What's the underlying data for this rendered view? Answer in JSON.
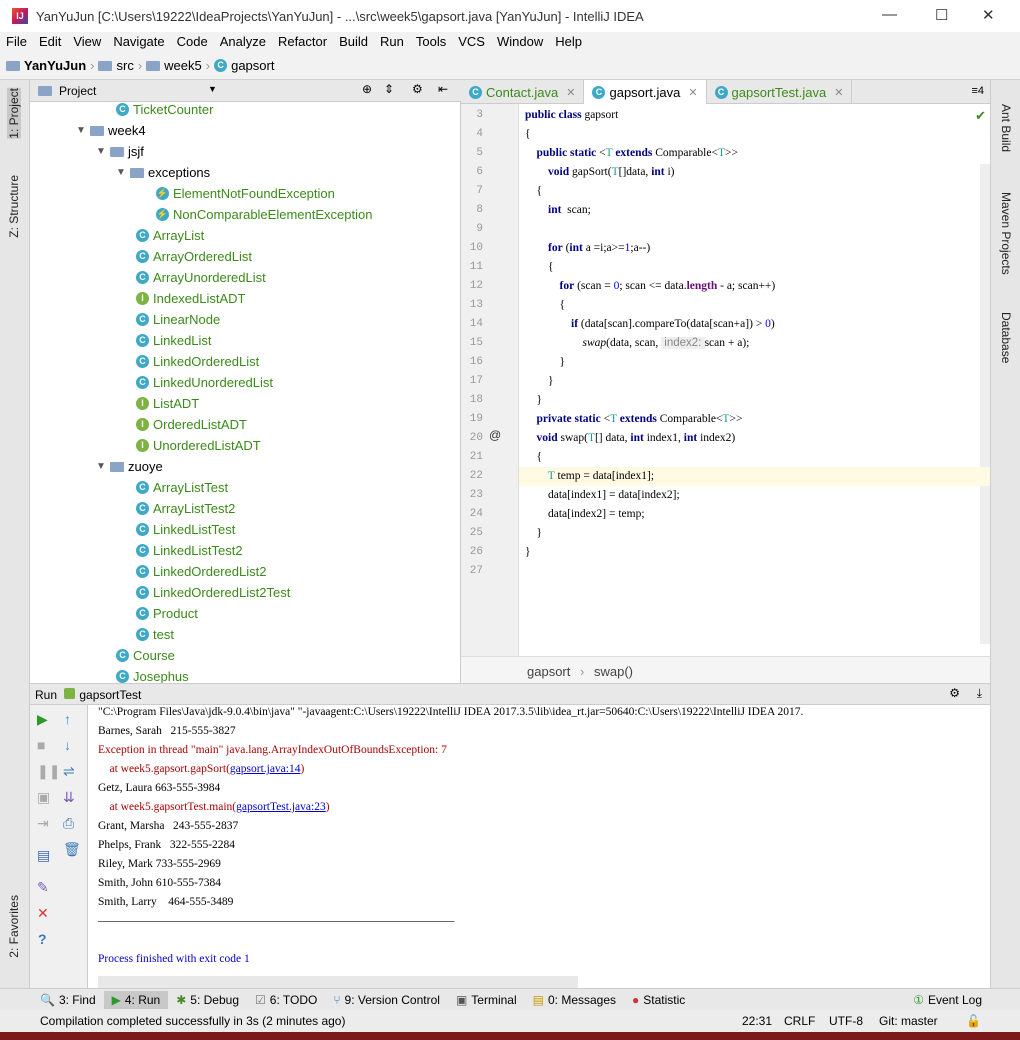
{
  "window": {
    "title": "YanYuJun [C:\\Users\\19222\\IdeaProjects\\YanYuJun] - ...\\src\\week5\\gapsort.java [YanYuJun] - IntelliJ IDEA",
    "minimize": "—",
    "maximize": "☐",
    "close": "✕"
  },
  "menu": [
    "File",
    "Edit",
    "View",
    "Navigate",
    "Code",
    "Analyze",
    "Refactor",
    "Build",
    "Run",
    "Tools",
    "VCS",
    "Window",
    "Help"
  ],
  "breadcrumb": [
    "YanYuJun",
    "src",
    "week5",
    "gapsort"
  ],
  "run_config": "gapsortTest",
  "left_tabs": [
    "1: Project",
    "Z: Structure",
    "2: Favorites"
  ],
  "right_tabs": [
    "Ant Build",
    "Maven Projects",
    "Database"
  ],
  "project_panel": {
    "title": "Project"
  },
  "tree": [
    {
      "label": "TicketCounter",
      "level": 1,
      "icon": "class",
      "kind": "file"
    },
    {
      "label": "week4",
      "level": 0,
      "icon": "folder",
      "kind": "dir"
    },
    {
      "label": "jsjf",
      "level": 1,
      "icon": "folder",
      "kind": "dir"
    },
    {
      "label": "exceptions",
      "level": 2,
      "icon": "folder",
      "kind": "dir"
    },
    {
      "label": "ElementNotFoundException",
      "level": 3,
      "icon": "exception",
      "kind": "file"
    },
    {
      "label": "NonComparableElementException",
      "level": 3,
      "icon": "exception",
      "kind": "file"
    },
    {
      "label": "ArrayList",
      "level": 2,
      "icon": "class",
      "kind": "file"
    },
    {
      "label": "ArrayOrderedList",
      "level": 2,
      "icon": "class",
      "kind": "file"
    },
    {
      "label": "ArrayUnorderedList",
      "level": 2,
      "icon": "class",
      "kind": "file"
    },
    {
      "label": "IndexedListADT",
      "level": 2,
      "icon": "interface",
      "kind": "file"
    },
    {
      "label": "LinearNode",
      "level": 2,
      "icon": "class",
      "kind": "file"
    },
    {
      "label": "LinkedList",
      "level": 2,
      "icon": "class",
      "kind": "file"
    },
    {
      "label": "LinkedOrderedList",
      "level": 2,
      "icon": "class",
      "kind": "file"
    },
    {
      "label": "LinkedUnorderedList",
      "level": 2,
      "icon": "class",
      "kind": "file"
    },
    {
      "label": "ListADT",
      "level": 2,
      "icon": "interface",
      "kind": "file"
    },
    {
      "label": "OrderedListADT",
      "level": 2,
      "icon": "interface",
      "kind": "file"
    },
    {
      "label": "UnorderedListADT",
      "level": 2,
      "icon": "interface",
      "kind": "file"
    },
    {
      "label": "zuoye",
      "level": 1,
      "icon": "folder",
      "kind": "dir"
    },
    {
      "label": "ArrayListTest",
      "level": 2,
      "icon": "class-main",
      "kind": "file"
    },
    {
      "label": "ArrayListTest2",
      "level": 2,
      "icon": "class-main",
      "kind": "file"
    },
    {
      "label": "LinkedListTest",
      "level": 2,
      "icon": "class-main",
      "kind": "file"
    },
    {
      "label": "LinkedListTest2",
      "level": 2,
      "icon": "class-main",
      "kind": "file"
    },
    {
      "label": "LinkedOrderedList2",
      "level": 2,
      "icon": "class",
      "kind": "file"
    },
    {
      "label": "LinkedOrderedList2Test",
      "level": 2,
      "icon": "class-main",
      "kind": "file"
    },
    {
      "label": "Product",
      "level": 2,
      "icon": "class",
      "kind": "file"
    },
    {
      "label": "test",
      "level": 2,
      "icon": "class-main",
      "kind": "file"
    },
    {
      "label": "Course",
      "level": 1,
      "icon": "class",
      "kind": "file"
    },
    {
      "label": "Josephus",
      "level": 1,
      "icon": "class-main",
      "kind": "file"
    }
  ],
  "editor_tabs": [
    {
      "label": "Contact.java",
      "active": false
    },
    {
      "label": "gapsort.java",
      "active": true
    },
    {
      "label": "gapsortTest.java",
      "active": false
    }
  ],
  "tabs_overflow": "≡4",
  "code_lines": [
    {
      "n": "3",
      "html": "<b style='color:#000080'>public class</b> gapsort"
    },
    {
      "n": "4",
      "html": "{"
    },
    {
      "n": "5",
      "html": "    <b style='color:#000080'>public static</b> &lt;<span style='color:#20999d'>T</span> <b style='color:#000080'>extends</b> Comparable&lt;<span style='color:#20999d'>T</span>&gt;&gt;"
    },
    {
      "n": "6",
      "html": "        <b style='color:#000080'>void</b> gapSort(<span style='color:#20999d'>T</span>[]data, <b style='color:#000080'>int</b> i)"
    },
    {
      "n": "7",
      "html": "    {"
    },
    {
      "n": "8",
      "html": "        <b style='color:#000080'>int</b>  scan;"
    },
    {
      "n": "9",
      "html": ""
    },
    {
      "n": "10",
      "html": "        <b style='color:#000080'>for</b> (<b style='color:#000080'>int</b> a =i;a&gt;=<span style='color:#00f'>1</span>;a--)"
    },
    {
      "n": "11",
      "html": "        {"
    },
    {
      "n": "12",
      "html": "            <b style='color:#000080'>for</b> (scan = <span style='color:#00f'>0</span>; scan &lt;= data.<b style='color:#660e7a'>length</b> - a; scan++)"
    },
    {
      "n": "13",
      "html": "            {"
    },
    {
      "n": "14",
      "html": "                <b style='color:#000080'>if</b> (data[scan].compareTo(data[scan+a]) &gt; <span style='color:#00f'>0</span>)"
    },
    {
      "n": "15",
      "html": "                    <i>swap</i>(data, scan, <span style='background:#eee;color:#888;font-family:Liberation Sans,sans-serif'> index2: </span>scan + a);"
    },
    {
      "n": "16",
      "html": "            }"
    },
    {
      "n": "17",
      "html": "        }"
    },
    {
      "n": "18",
      "html": "    }"
    },
    {
      "n": "19",
      "html": "    <b style='color:#000080'>private static</b> &lt;<span style='color:#20999d'>T</span> <b style='color:#000080'>extends</b> Comparable&lt;<span style='color:#20999d'>T</span>&gt;&gt;"
    },
    {
      "n": "20",
      "html": "    <b style='color:#000080'>void</b> swap(<span style='color:#20999d'>T</span>[] data, <b style='color:#000080'>int</b> index1, <b style='color:#000080'>int</b> index2)"
    },
    {
      "n": "21",
      "html": "    {"
    },
    {
      "n": "22",
      "html": "        <span style='color:#20999d'>T</span> temp = data[index1];"
    },
    {
      "n": "23",
      "html": "        data[index1] = data[index2];"
    },
    {
      "n": "24",
      "html": "        data[index2] = temp;"
    },
    {
      "n": "25",
      "html": "    }"
    },
    {
      "n": "26",
      "html": "}"
    },
    {
      "n": "27",
      "html": ""
    }
  ],
  "editor_breadcrumb": [
    "gapsort",
    "swap()"
  ],
  "run_panel": {
    "label": "Run",
    "config": "gapsortTest"
  },
  "console": [
    {
      "t": "\"C:\\Program Files\\Java\\jdk-9.0.4\\bin\\java\" \"-javaagent:C:\\Users\\19222\\IntelliJ IDEA 2017.3.5\\lib\\idea_rt.jar=50640:C:\\Users\\19222\\IntelliJ IDEA 2017.",
      "c": ""
    },
    {
      "t": "Barnes, Sarah   215-555-3827",
      "c": ""
    },
    {
      "t": "Exception in thread \"main\" java.lang.ArrayIndexOutOfBoundsException: 7",
      "c": "err"
    },
    {
      "t": "    at week5.gapsort.gapSort(",
      "link": "gapsort.java:14",
      "after": ")",
      "c": "err"
    },
    {
      "t": "Getz, Laura 663-555-3984",
      "c": ""
    },
    {
      "t": "    at week5.gapsortTest.main(",
      "link": "gapsortTest.java:23",
      "after": ")",
      "c": "err"
    },
    {
      "t": "Grant, Marsha   243-555-2837",
      "c": ""
    },
    {
      "t": "Phelps, Frank   322-555-2284",
      "c": ""
    },
    {
      "t": "Riley, Mark 733-555-2969",
      "c": ""
    },
    {
      "t": "Smith, John 610-555-7384",
      "c": ""
    },
    {
      "t": "Smith, Larry    464-555-3489",
      "c": ""
    },
    {
      "t": "———————————————————————————————",
      "c": ""
    },
    {
      "t": "",
      "c": ""
    },
    {
      "t": "Process finished with exit code 1",
      "c": "blue"
    }
  ],
  "tool_windows": [
    "3: Find",
    "4: Run",
    "5: Debug",
    "6: TODO",
    "9: Version Control",
    "Terminal",
    "0: Messages",
    "Statistic",
    "Event Log"
  ],
  "status": {
    "message": "Compilation completed successfully in 3s (2 minutes ago)",
    "position": "22:31",
    "line_sep": "CRLF",
    "encoding": "UTF-8",
    "vcs": "Git: master"
  }
}
